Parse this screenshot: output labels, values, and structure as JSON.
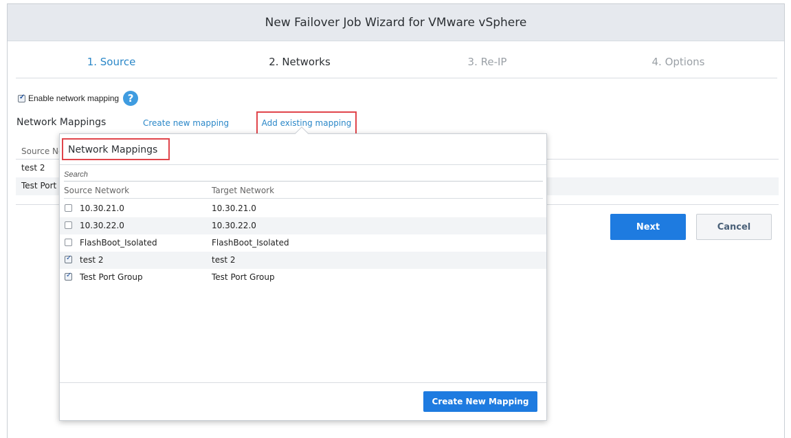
{
  "window": {
    "title": "New Failover Job Wizard for VMware vSphere"
  },
  "steps": [
    {
      "label": "1. Source",
      "state": "completed"
    },
    {
      "label": "2. Networks",
      "state": "active"
    },
    {
      "label": "3. Re-IP",
      "state": "pending"
    },
    {
      "label": "4. Options",
      "state": "pending"
    }
  ],
  "enable_mapping": {
    "label": "Enable network mapping",
    "checked": true,
    "help_icon": "question-circle-icon"
  },
  "network_mappings": {
    "label": "Network Mappings",
    "create_link": "Create new mapping",
    "add_link": "Add existing mapping",
    "table": {
      "header": "Source Ne",
      "rows": [
        "test 2",
        "Test Port"
      ]
    }
  },
  "buttons": {
    "next": "Next",
    "cancel": "Cancel"
  },
  "popup": {
    "title": "Network Mappings",
    "search_placeholder": "Search",
    "columns": [
      "Source Network",
      "Target Network"
    ],
    "rows": [
      {
        "source": "10.30.21.0",
        "target": "10.30.21.0",
        "checked": false
      },
      {
        "source": "10.30.22.0",
        "target": "10.30.22.0",
        "checked": false
      },
      {
        "source": "FlashBoot_Isolated",
        "target": "FlashBoot_Isolated",
        "checked": false
      },
      {
        "source": "test 2",
        "target": "test 2",
        "checked": true
      },
      {
        "source": "Test Port Group",
        "target": "Test Port Group",
        "checked": true
      }
    ],
    "create_button": "Create New Mapping"
  },
  "colors": {
    "accent": "#1e7be0",
    "link": "#2a87c8",
    "highlight_border": "#e0444a"
  }
}
